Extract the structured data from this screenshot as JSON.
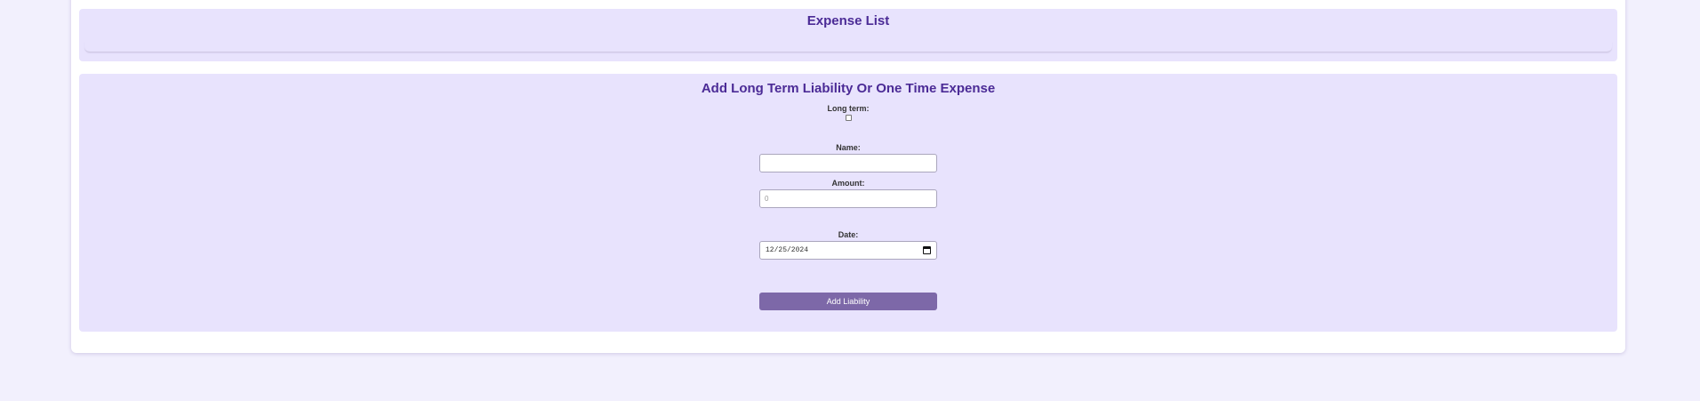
{
  "expense_list": {
    "title": "Expense List"
  },
  "add_form": {
    "title": "Add Long Term Liability Or One Time Expense",
    "long_term_label": "Long term:",
    "long_term_checked": false,
    "name_label": "Name:",
    "name_value": "",
    "amount_label": "Amount:",
    "amount_placeholder": "0",
    "date_label": "Date:",
    "date_value": "12/25/2024",
    "submit_label": "Add Liability"
  },
  "colors": {
    "background": "#f2f0fd",
    "panel": "#e8e3fd",
    "heading": "#4b2b96",
    "button": "#7d68a8"
  },
  "icons": {
    "date_picker": "calendar-icon"
  }
}
